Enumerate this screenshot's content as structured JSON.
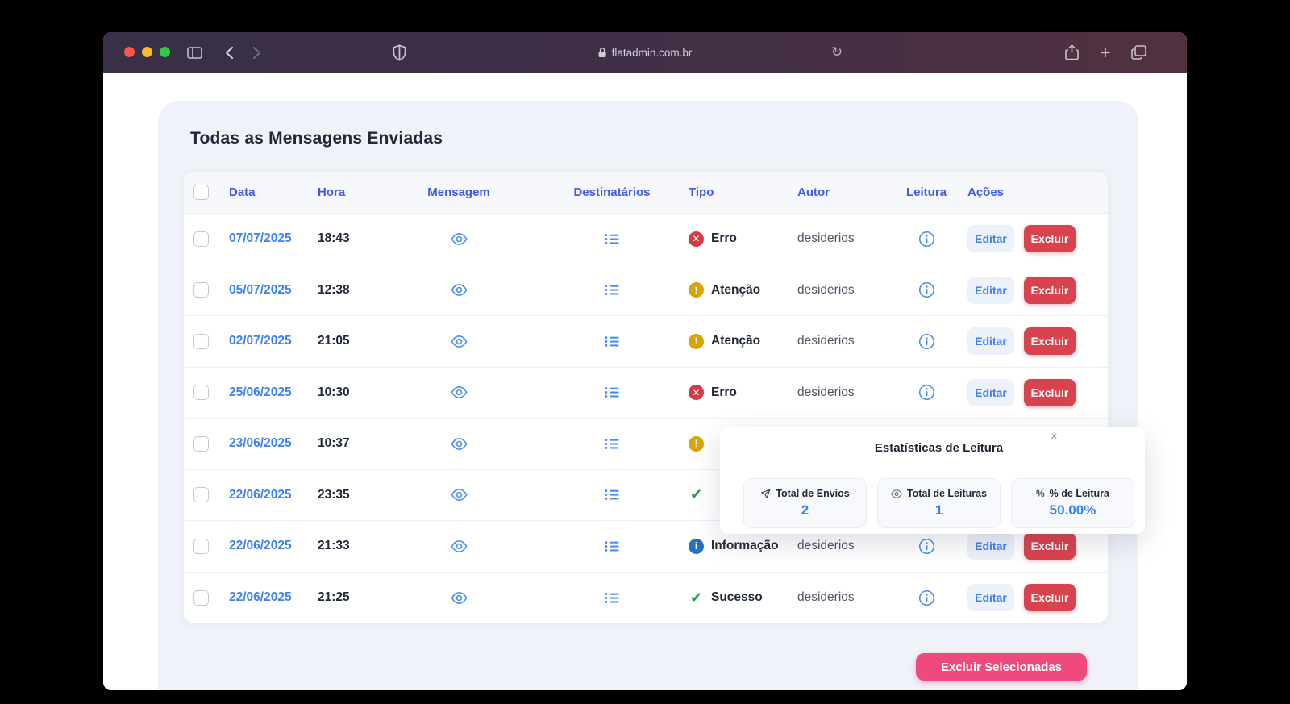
{
  "browser": {
    "url": "flatadmin.com.br"
  },
  "page": {
    "title": "Todas as Mensagens Enviadas",
    "table": {
      "headers": {
        "data": "Data",
        "hora": "Hora",
        "mensagem": "Mensagem",
        "destinatarios": "Destinatários",
        "tipo": "Tipo",
        "autor": "Autor",
        "leitura": "Leitura",
        "acoes": "Ações"
      },
      "actions": {
        "edit": "Editar",
        "delete": "Excluir"
      },
      "rows": [
        {
          "date": "07/07/2025",
          "time": "18:43",
          "type": "erro",
          "type_label": "Erro",
          "author": "desiderios",
          "covered": false
        },
        {
          "date": "05/07/2025",
          "time": "12:38",
          "type": "atencao",
          "type_label": "Atenção",
          "author": "desiderios",
          "covered": false
        },
        {
          "date": "02/07/2025",
          "time": "21:05",
          "type": "atencao",
          "type_label": "Atenção",
          "author": "desiderios",
          "covered": false
        },
        {
          "date": "25/06/2025",
          "time": "10:30",
          "type": "erro",
          "type_label": "Erro",
          "author": "desiderios",
          "covered": false
        },
        {
          "date": "23/06/2025",
          "time": "10:37",
          "type": "atencao",
          "type_label": "",
          "author": "",
          "covered": true
        },
        {
          "date": "22/06/2025",
          "time": "23:35",
          "type": "sucesso",
          "type_label": "",
          "author": "",
          "covered": true
        },
        {
          "date": "22/06/2025",
          "time": "21:33",
          "type": "informacao",
          "type_label": "Informação",
          "author": "desiderios",
          "covered": false
        },
        {
          "date": "22/06/2025",
          "time": "21:25",
          "type": "sucesso",
          "type_label": "Sucesso",
          "author": "desiderios",
          "covered": false
        }
      ]
    },
    "bulk_delete_label": "Excluir Selecionadas"
  },
  "popup": {
    "title": "Estatísticas de Leitura",
    "close": "✕",
    "stats": [
      {
        "icon": "send-icon",
        "label": "Total de Envios",
        "value": "2"
      },
      {
        "icon": "eye-icon",
        "label": "Total de Leituras",
        "value": "1"
      },
      {
        "icon": "percent-icon",
        "label": "% de Leitura",
        "value": "50.00%"
      }
    ]
  },
  "colors": {
    "header_blue": "#4159ec",
    "link_blue": "#3e82f0",
    "erro_red": "#d63a45",
    "atencao_amber": "#d9a40a",
    "info_blue": "#1f74c9",
    "sucesso_green": "#1f9d49",
    "excluir_red": "#d9434e",
    "bulk_pink": "#ee4a7e",
    "panel_bg": "#f0f2f9"
  }
}
